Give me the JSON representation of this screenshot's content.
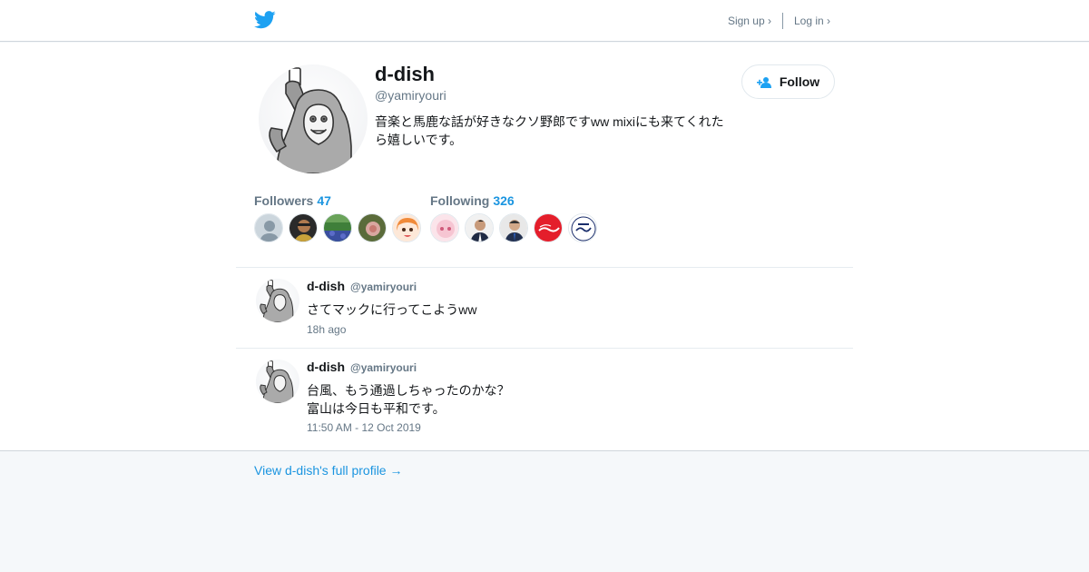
{
  "header": {
    "logo": "twitter-bird-icon",
    "signup": "Sign up ›",
    "login": "Log in ›"
  },
  "profile": {
    "name": "d-dish",
    "handle": "@yamiryouri",
    "bio": "音楽と馬鹿な話が好きなクソ野郎ですww mixiにも来てくれたら嬉しいです。",
    "follow_label": "Follow"
  },
  "stats": {
    "followers_label": "Followers",
    "followers_count": "47",
    "following_label": "Following",
    "following_count": "326"
  },
  "follower_avatars": [
    "default-avatar",
    "person-photo",
    "green-garden",
    "rose-flower",
    "anime-girl"
  ],
  "following_avatars": [
    "pink-anime",
    "man-suit",
    "man-suit-2",
    "coca-cola-logo",
    "sweets-logo"
  ],
  "tweets": [
    {
      "name": "d-dish",
      "handle": "@yamiryouri",
      "lines": [
        "さてマックに行ってこようww"
      ],
      "time": "18h ago"
    },
    {
      "name": "d-dish",
      "handle": "@yamiryouri",
      "lines": [
        "台風、もう通過しちゃったのかな？",
        "富山は今日も平和です。"
      ],
      "time": "11:50 AM - 12 Oct 2019"
    }
  ],
  "footer": {
    "link": "View d-dish's full profile →"
  },
  "colors": {
    "accent": "#1b95e0",
    "bird": "#1da1f2",
    "muted": "#657786",
    "background": "#f5f8fa"
  }
}
